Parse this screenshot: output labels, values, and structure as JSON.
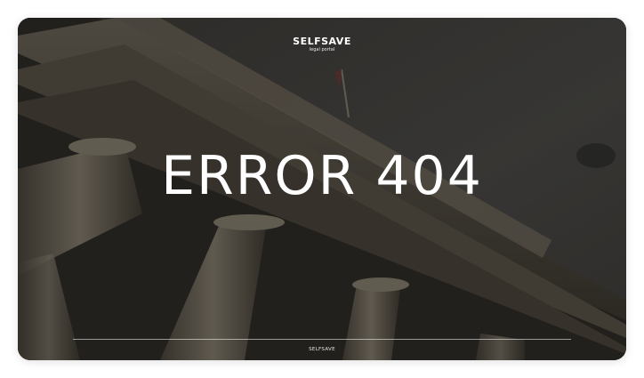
{
  "header": {
    "brand_name": "SELFSAVE",
    "brand_tagline": "legal portal"
  },
  "main": {
    "headline": "ERROR 404"
  },
  "footer": {
    "text": "SELFSAVE"
  },
  "colors": {
    "text": "#ffffff",
    "sky": "#4a4846",
    "stone": "#6b6459",
    "page_background": "#ffffff"
  },
  "background": {
    "subject": "courthouse-columns-photo"
  }
}
